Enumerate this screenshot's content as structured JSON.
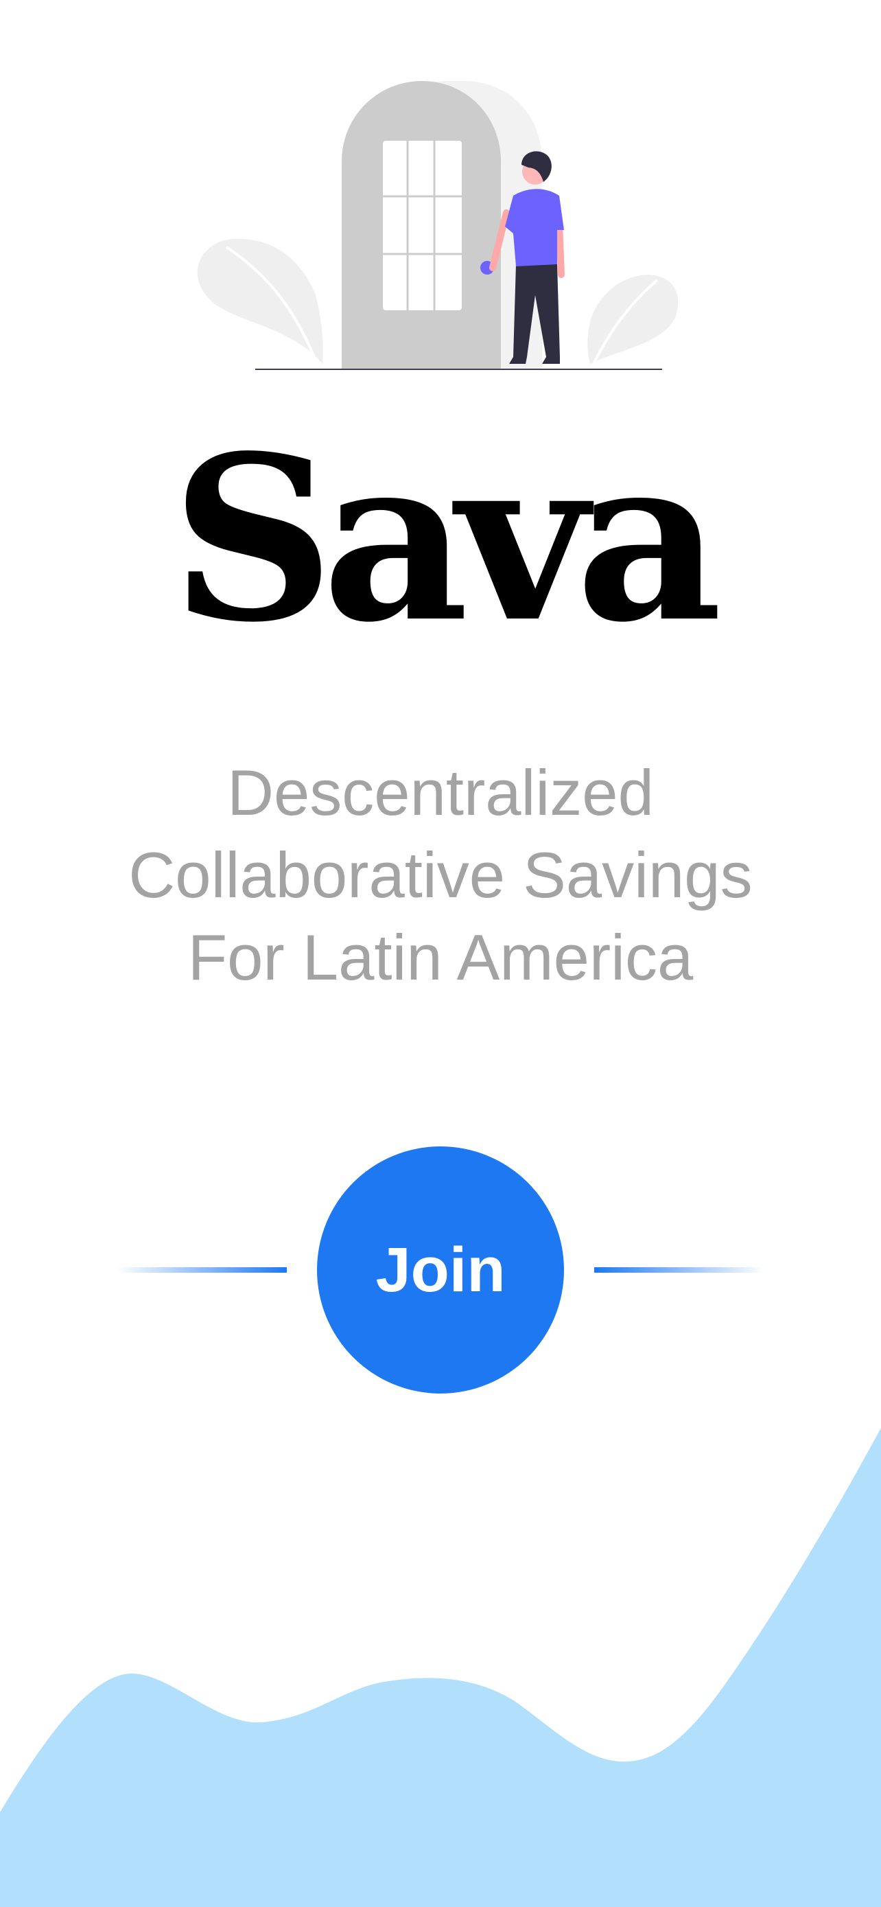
{
  "brand": {
    "name": "Sava"
  },
  "tagline": {
    "line1": "Descentralized",
    "line2": "Collaborative Savings",
    "line3": "For Latin America"
  },
  "cta": {
    "join_label": "Join"
  },
  "colors": {
    "accent": "#1d78f2",
    "wave": "#b2dffb",
    "tagline_text": "#a3a3a3",
    "figure_shirt": "#6c63ff"
  },
  "icons": {
    "hero": "person-opening-door-illustration",
    "background": "wave-shape"
  }
}
